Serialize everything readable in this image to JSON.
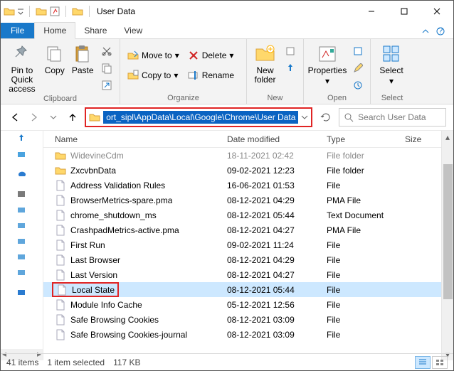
{
  "window": {
    "title": "User Data"
  },
  "tabs": {
    "file": "File",
    "home": "Home",
    "share": "Share",
    "view": "View"
  },
  "ribbon": {
    "clipboard": {
      "label": "Clipboard",
      "pin": "Pin to Quick access",
      "copy": "Copy",
      "paste": "Paste"
    },
    "organize": {
      "label": "Organize",
      "moveto": "Move to",
      "copyto": "Copy to",
      "delete": "Delete",
      "rename": "Rename"
    },
    "new": {
      "label": "New",
      "newfolder": "New folder"
    },
    "open": {
      "label": "Open",
      "properties": "Properties"
    },
    "select": {
      "label": "Select",
      "select": "Select"
    }
  },
  "address": {
    "path": "ort_sipl\\AppData\\Local\\Google\\Chrome\\User Data"
  },
  "search": {
    "placeholder": "Search User Data"
  },
  "columns": {
    "name": "Name",
    "date": "Date modified",
    "type": "Type",
    "size": "Size"
  },
  "files": [
    {
      "name": "WidevineCdm",
      "date": "18-11-2021 02:42",
      "type": "File folder",
      "kind": "folder",
      "cut": true
    },
    {
      "name": "ZxcvbnData",
      "date": "09-02-2021 12:23",
      "type": "File folder",
      "kind": "folder"
    },
    {
      "name": "Address Validation Rules",
      "date": "16-06-2021 01:53",
      "type": "File",
      "kind": "file"
    },
    {
      "name": "BrowserMetrics-spare.pma",
      "date": "08-12-2021 04:29",
      "type": "PMA File",
      "kind": "file"
    },
    {
      "name": "chrome_shutdown_ms",
      "date": "08-12-2021 05:44",
      "type": "Text Document",
      "kind": "file"
    },
    {
      "name": "CrashpadMetrics-active.pma",
      "date": "08-12-2021 04:27",
      "type": "PMA File",
      "kind": "file"
    },
    {
      "name": "First Run",
      "date": "09-02-2021 11:24",
      "type": "File",
      "kind": "file"
    },
    {
      "name": "Last Browser",
      "date": "08-12-2021 04:29",
      "type": "File",
      "kind": "file"
    },
    {
      "name": "Last Version",
      "date": "08-12-2021 04:27",
      "type": "File",
      "kind": "file"
    },
    {
      "name": "Local State",
      "date": "08-12-2021 05:44",
      "type": "File",
      "kind": "file",
      "selected": true,
      "highlight": true
    },
    {
      "name": "Module Info Cache",
      "date": "05-12-2021 12:56",
      "type": "File",
      "kind": "file"
    },
    {
      "name": "Safe Browsing Cookies",
      "date": "08-12-2021 03:09",
      "type": "File",
      "kind": "file"
    },
    {
      "name": "Safe Browsing Cookies-journal",
      "date": "08-12-2021 03:09",
      "type": "File",
      "kind": "file"
    }
  ],
  "status": {
    "count": "41 items",
    "selected": "1 item selected",
    "size": "117 KB"
  }
}
